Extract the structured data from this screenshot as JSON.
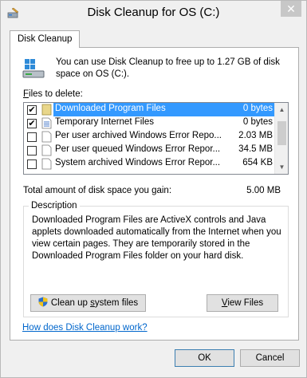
{
  "window": {
    "title": "Disk Cleanup for OS (C:)",
    "close_symbol": "✕"
  },
  "tab": {
    "label": "Disk Cleanup"
  },
  "intro": {
    "text": "You can use Disk Cleanup to free up to 1.27 GB of disk space on OS (C:)."
  },
  "files_label": {
    "mnemonic": "F",
    "rest": "iles to delete:"
  },
  "files": [
    {
      "name": "Downloaded Program Files",
      "size": "0 bytes",
      "checked": true,
      "selected": true,
      "icon": "folder-icon"
    },
    {
      "name": "Temporary Internet Files",
      "size": "0 bytes",
      "checked": true,
      "selected": false,
      "icon": "document-lines-icon"
    },
    {
      "name": "Per user archived Windows Error Repo...",
      "size": "2.03 MB",
      "checked": false,
      "selected": false,
      "icon": "document-icon"
    },
    {
      "name": "Per user queued Windows Error Repor...",
      "size": "34.5 MB",
      "checked": false,
      "selected": false,
      "icon": "document-icon"
    },
    {
      "name": "System archived Windows Error Repor...",
      "size": "654 KB",
      "checked": false,
      "selected": false,
      "icon": "document-icon"
    }
  ],
  "total": {
    "label": "Total amount of disk space you gain:",
    "value": "5.00 MB"
  },
  "description": {
    "legend": "Description",
    "text": "Downloaded Program Files are ActiveX controls and Java applets downloaded automatically from the Internet when you view certain pages. They are temporarily stored in the Downloaded Program Files folder on your hard disk."
  },
  "buttons": {
    "cleanup": {
      "before": "Clean up ",
      "mnemonic": "s",
      "after": "ystem files"
    },
    "view": {
      "mnemonic": "V",
      "after": "iew Files"
    },
    "ok": "OK",
    "cancel": "Cancel"
  },
  "help_link": "How does Disk Cleanup work?",
  "colors": {
    "selection": "#3399ff",
    "link": "#0066cc"
  }
}
